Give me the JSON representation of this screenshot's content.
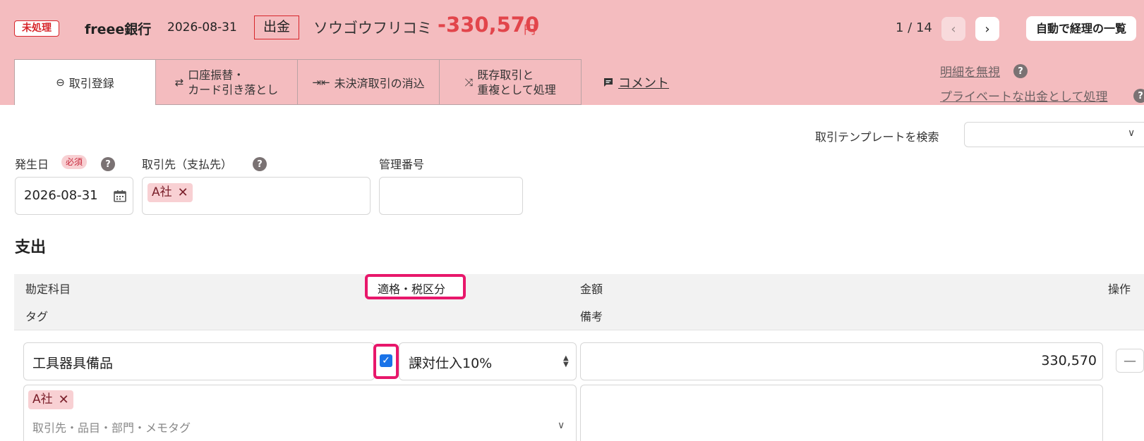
{
  "header": {
    "status_badge": "未処理",
    "bank_name": "freee銀行",
    "date": "2026-08-31",
    "type_badge": "出金",
    "payee": "ソウゴウフリコミ",
    "amount": "-330,570",
    "currency": "円",
    "pager": "1 / 14",
    "prev_icon": "‹",
    "next_icon": "›",
    "auto_list_button": "自動で経理の一覧"
  },
  "tabs": [
    {
      "label": "取引登録",
      "icon": "⊖"
    },
    {
      "label": "口座振替・\nカード引き落とし",
      "icon": "⇄"
    },
    {
      "label": "未決済取引の消込",
      "icon": "⇥⇤"
    },
    {
      "label": "既存取引と\n重複として処理",
      "icon": "⤨"
    }
  ],
  "comment_link": "コメント",
  "links": {
    "ignore": "明細を無視",
    "private": "プライベートな出金として処理"
  },
  "template_search": {
    "label": "取引テンプレートを検索",
    "value": ""
  },
  "form": {
    "date_label": "発生日",
    "required_badge": "必須",
    "date_value": "2026-08-31",
    "partner_label": "取引先（支払先）",
    "partner_chip": "A社",
    "management_label": "管理番号",
    "management_value": ""
  },
  "section_title": "支出",
  "table_headers": {
    "account": "勘定科目",
    "tax": "適格・税区分",
    "amount": "金額",
    "action": "操作",
    "tag": "タグ",
    "note": "備考"
  },
  "row": {
    "account": "工具器具備品",
    "qualified_checked": true,
    "tax": "課対仕入10%",
    "amount": "330,570",
    "tag_chip": "A社",
    "tag_placeholder": "取引先・品目・部門・メモタグ",
    "note": ""
  },
  "colors": {
    "header_bg": "#f4bcbf",
    "accent_red": "#e2454b",
    "highlight": "#e8176b",
    "chip_bg": "#f8d0d3"
  }
}
